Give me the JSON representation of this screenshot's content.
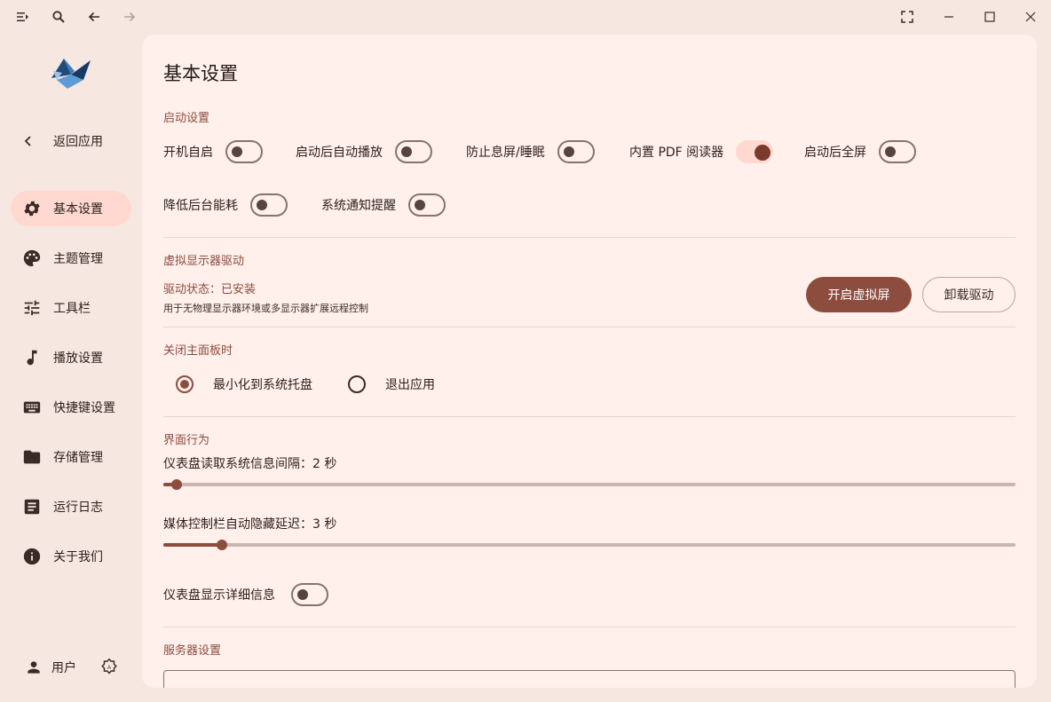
{
  "sidebar": {
    "back_label": "返回应用",
    "items": [
      {
        "label": "基本设置",
        "icon": "gear-icon",
        "active": true
      },
      {
        "label": "主题管理",
        "icon": "palette-icon",
        "active": false
      },
      {
        "label": "工具栏",
        "icon": "tune-icon",
        "active": false
      },
      {
        "label": "播放设置",
        "icon": "music-note-icon",
        "active": false
      },
      {
        "label": "快捷键设置",
        "icon": "keyboard-icon",
        "active": false
      },
      {
        "label": "存储管理",
        "icon": "folder-icon",
        "active": false
      },
      {
        "label": "运行日志",
        "icon": "log-icon",
        "active": false
      },
      {
        "label": "关于我们",
        "icon": "info-icon",
        "active": false
      }
    ],
    "user_label": "用户"
  },
  "page": {
    "title": "基本设置",
    "startup": {
      "section": "启动设置",
      "toggles": [
        {
          "label": "开机自启",
          "on": false
        },
        {
          "label": "启动后自动播放",
          "on": false
        },
        {
          "label": "防止息屏/睡眠",
          "on": false
        },
        {
          "label": "内置 PDF 阅读器",
          "on": true
        },
        {
          "label": "启动后全屏",
          "on": false
        },
        {
          "label": "降低后台能耗",
          "on": false
        },
        {
          "label": "系统通知提醒",
          "on": false
        }
      ]
    },
    "virtual_display": {
      "section": "虚拟显示器驱动",
      "status": "驱动状态：已安装",
      "description": "用于无物理显示器环境或多显示器扩展远程控制",
      "enable_button": "开启虚拟屏",
      "uninstall_button": "卸载驱动"
    },
    "close_panel": {
      "section": "关闭主面板时",
      "options": [
        {
          "label": "最小化到系统托盘",
          "selected": true
        },
        {
          "label": "退出应用",
          "selected": false
        }
      ]
    },
    "ui_behavior": {
      "section": "界面行为",
      "dashboard_interval_label": "仪表盘读取系统信息间隔：2 秒",
      "dashboard_interval_fraction": 0.016,
      "media_hide_label": "媒体控制栏自动隐藏延迟：3 秒",
      "media_hide_fraction": 0.069,
      "details_label": "仪表盘显示详细信息",
      "details_on": false
    },
    "server": {
      "section": "服务器设置",
      "input_value": ""
    }
  },
  "colors": {
    "accent": "#8c4c3e",
    "window_bg": "#f6e7e1",
    "panel_bg": "#fff0ec",
    "active_nav": "#ffd9cf"
  }
}
